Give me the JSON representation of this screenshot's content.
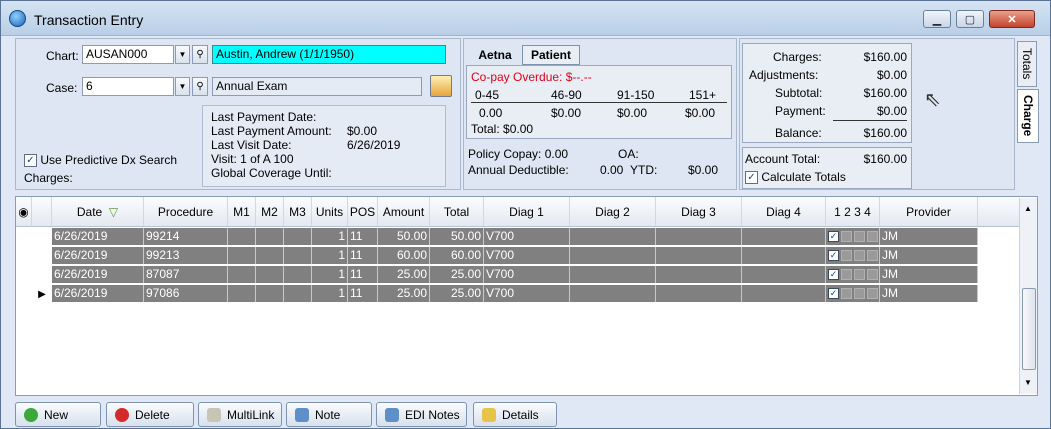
{
  "window": {
    "title": "Transaction Entry"
  },
  "chart": {
    "label": "Chart:",
    "value": "AUSAN000",
    "patient": "Austin, Andrew  (1/1/1950)"
  },
  "case": {
    "label": "Case:",
    "value": "6",
    "description": "Annual Exam"
  },
  "predictive": {
    "label": "Use Predictive Dx Search",
    "checked": true
  },
  "charges_label": "Charges:",
  "payment_info": {
    "last_payment_date_label": "Last Payment Date:",
    "last_payment_amount_label": "Last Payment Amount:",
    "last_payment_amount": "$0.00",
    "last_visit_date_label": "Last Visit Date:",
    "last_visit_date": "6/26/2019",
    "visit_line": "Visit:   1   of  A 100",
    "global_coverage_label": "Global Coverage Until:"
  },
  "insurance": {
    "tabs": [
      "Aetna",
      "Patient"
    ],
    "copay_overdue": "Co-pay Overdue: $--.--",
    "aging_headers": [
      "0-45",
      "46-90",
      "91-150",
      "151+"
    ],
    "aging_values": [
      "0.00",
      "$0.00",
      "$0.00",
      "$0.00"
    ],
    "total": "Total: $0.00",
    "policy_copay": "Policy Copay: 0.00",
    "oa_label": "OA:",
    "annual_deductible": "Annual Deductible:",
    "deductible_value": "0.00",
    "ytd_label": "YTD:",
    "ytd_value": "$0.00"
  },
  "totals": {
    "charges_label": "Charges:",
    "charges": "$160.00",
    "adjustments_label": "Adjustments:",
    "adjustments": "$0.00",
    "subtotal_label": "Subtotal:",
    "subtotal": "$160.00",
    "payment_label": "Payment:",
    "payment": "$0.00",
    "balance_label": "Balance:",
    "balance": "$160.00",
    "account_total_label": "Account Total:",
    "account_total": "$160.00",
    "calculate_label": "Calculate Totals"
  },
  "side_tabs": {
    "totals": "Totals",
    "charge": "Charge"
  },
  "grid": {
    "headers": [
      "Date",
      "Procedure",
      "M1",
      "M2",
      "M3",
      "Units",
      "POS",
      "Amount",
      "Total",
      "Diag 1",
      "Diag 2",
      "Diag 3",
      "Diag 4",
      "1 2 3 4",
      "Provider"
    ],
    "rows": [
      {
        "date": "6/26/2019",
        "procedure": "99214",
        "units": "1",
        "pos": "11",
        "amount": "50.00",
        "total": "50.00",
        "diag1": "V700",
        "provider": "JM"
      },
      {
        "date": "6/26/2019",
        "procedure": "99213",
        "units": "1",
        "pos": "11",
        "amount": "60.00",
        "total": "60.00",
        "diag1": "V700",
        "provider": "JM"
      },
      {
        "date": "6/26/2019",
        "procedure": "87087",
        "units": "1",
        "pos": "11",
        "amount": "25.00",
        "total": "25.00",
        "diag1": "V700",
        "provider": "JM"
      },
      {
        "date": "6/26/2019",
        "procedure": "97086",
        "units": "1",
        "pos": "11",
        "amount": "25.00",
        "total": "25.00",
        "diag1": "V700",
        "provider": "JM"
      }
    ]
  },
  "buttons": {
    "new": "New",
    "delete": "Delete",
    "multilink": "MultiLink",
    "note": "Note",
    "edi_notes": "EDI Notes",
    "details": "Details"
  }
}
